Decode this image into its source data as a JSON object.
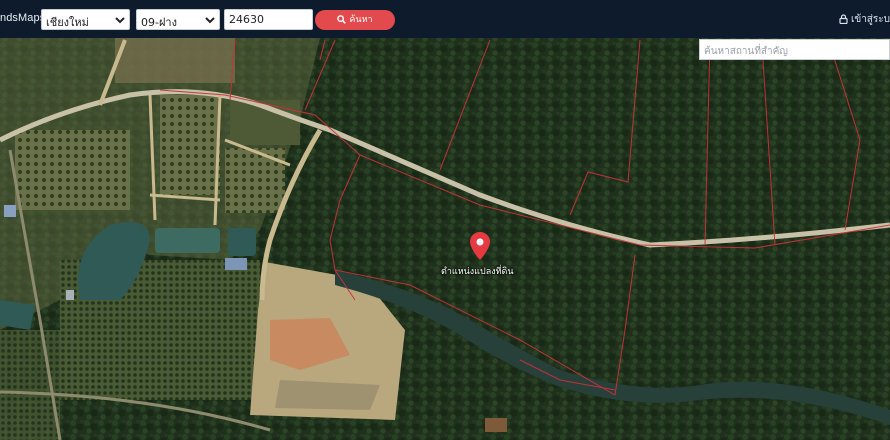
{
  "topbar": {
    "brand": "ndsMaps",
    "province_select": "เชียงใหม่",
    "district_select": "09-ฝาง",
    "deed_number": "24630",
    "search_button": "ค้นหา",
    "login_link": "เข้าสู่ระบ"
  },
  "map": {
    "place_search_placeholder": "ค้นหาสถานที่สำคัญ",
    "marker_label": "ตำแหน่งแปลงที่ดิน"
  },
  "icons": {
    "search": "search-icon",
    "lock": "lock-icon",
    "chevron": "chevron-down-icon",
    "pin": "map-pin-icon"
  },
  "colors": {
    "topbar": "#0d1b2d",
    "search_button": "#e34a4d",
    "marker": "#e53a3f",
    "parcel_lines": "#c8323a"
  }
}
